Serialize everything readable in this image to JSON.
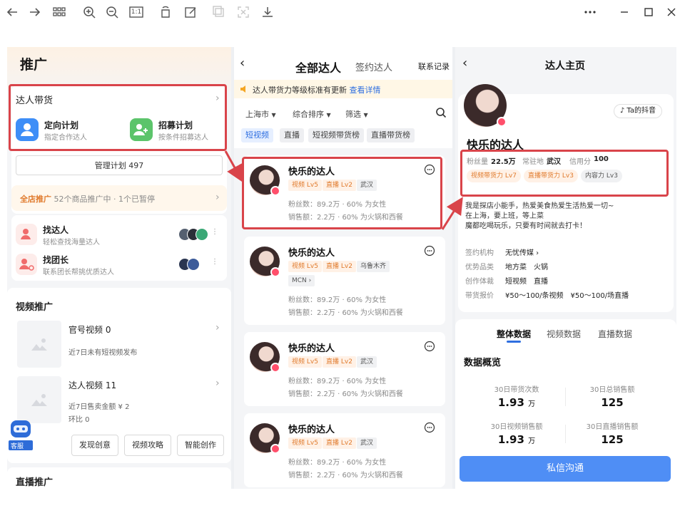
{
  "toolbar": {
    "icons": [
      "back-arrow-icon",
      "forward-arrow-icon",
      "grid-icon",
      "zoom-in-icon",
      "zoom-out-icon",
      "actual-size-icon",
      "rotate-icon",
      "edit-icon",
      "copy-icon",
      "crop-icon",
      "download-icon"
    ],
    "actual_size_label": "1:1",
    "window_buttons": [
      "more-icon",
      "minimize-icon",
      "maximize-icon",
      "close-icon"
    ]
  },
  "promo": {
    "title": "推广",
    "kol_section": {
      "title": "达人带货",
      "plans": [
        {
          "title": "定向计划",
          "subtitle": "指定合作达人"
        },
        {
          "title": "招募计划",
          "subtitle": "按条件招募达人"
        }
      ],
      "manage_label": "管理计划 497"
    },
    "store_promo": {
      "label": "全店推广",
      "text": "52个商品推广中 · 1个已暂停"
    },
    "finders": [
      {
        "title": "找达人",
        "subtitle": "轻松查找海量达人"
      },
      {
        "title": "找团长",
        "subtitle": "联系团长帮挑优质达人"
      }
    ],
    "video_section": {
      "title": "视频推广",
      "official": {
        "title": "官号视频 0",
        "note": "近7日未有短视频发布"
      },
      "kol": {
        "title": "达人视频 11",
        "sales": "近7日售卖金额 ¥ 2",
        "ratio": "环比 0"
      },
      "buttons": [
        "发现创意",
        "视频攻略",
        "智能创作"
      ]
    },
    "live_section_title": "直播推广",
    "service_label": "客服"
  },
  "kol_list": {
    "tabs": {
      "all": "全部达人",
      "signed": "签约达人",
      "records": "联系记录"
    },
    "banner": {
      "text": "达人带货力等级标准有更新",
      "link": "查看详情"
    },
    "filters": [
      "上海市",
      "综合排序",
      "筛选"
    ],
    "chips": [
      "短视频",
      "直播",
      "短视频带货榜",
      "直播带货榜"
    ],
    "cards": [
      {
        "name": "快乐的达人",
        "tags": [
          "视频 Lv5",
          "直播 Lv2"
        ],
        "location": "武汉",
        "mcn": "",
        "fans": "粉丝数：89.2万 · 60% 为女性",
        "sales": "销售额：2.2万 · 60% 为火锅和西餐"
      },
      {
        "name": "快乐的达人",
        "tags": [
          "视频 Lv5",
          "直播 Lv2"
        ],
        "location": "乌鲁木齐",
        "mcn": "MCN",
        "fans": "粉丝数：89.2万 · 60% 为女性",
        "sales": "销售额：2.2万 · 60% 为火锅和西餐"
      },
      {
        "name": "快乐的达人",
        "tags": [
          "视频 Lv5",
          "直播 Lv2"
        ],
        "location": "武汉",
        "mcn": "",
        "fans": "粉丝数：89.2万 · 60% 为女性",
        "sales": "销售额：2.2万 · 60% 为火锅和西餐"
      },
      {
        "name": "快乐的达人",
        "tags": [
          "视频 Lv5",
          "直播 Lv2"
        ],
        "location": "武汉",
        "mcn": "",
        "fans": "粉丝数：89.2万 · 60% 为女性",
        "sales": "销售额：2.2万 · 60% 为火锅和西餐"
      }
    ]
  },
  "kol_profile": {
    "title": "达人主页",
    "douyin_button": "Ta的抖音",
    "name": "快乐的达人",
    "stats": [
      {
        "label": "粉丝量",
        "value": "22.5万"
      },
      {
        "label": "常驻地",
        "value": "武汉"
      },
      {
        "label": "信用分",
        "value": "100"
      }
    ],
    "tags": [
      "视频带货力 Lv7",
      "直播带货力 Lv3",
      "内容力 Lv3"
    ],
    "bio": [
      "我是探店小能手，热爱美食热爱生活热爱一切~",
      "在上海，要上班，等上菜",
      "魔都吃喝玩乐，只要有时间就去打卡！"
    ],
    "info": [
      {
        "label": "签约机构",
        "value": "无忧传媒"
      },
      {
        "label": "优势品类",
        "value": "地方菜　火锅"
      },
      {
        "label": "创作体裁",
        "value": "短视频　直播"
      },
      {
        "label": "带货报价",
        "value": "¥50～100/条视频　¥50～100/场直播"
      }
    ],
    "data_tabs": [
      "整体数据",
      "视频数据",
      "直播数据"
    ],
    "overview_title": "数据概览",
    "metrics": [
      {
        "label": "30日带货次数",
        "value": "1.93",
        "unit": "万"
      },
      {
        "label": "30日总销售额",
        "value": "125",
        "unit": ""
      },
      {
        "label": "30日视频销售额",
        "value": "1.93",
        "unit": "万"
      },
      {
        "label": "30日直播销售额",
        "value": "125",
        "unit": ""
      }
    ],
    "cta": "私信沟通"
  },
  "colors": {
    "accent": "#4f8ef5",
    "highlight": "#d9444a",
    "tag_orange": "#e07a2c",
    "link_blue": "#2f6fe0"
  }
}
